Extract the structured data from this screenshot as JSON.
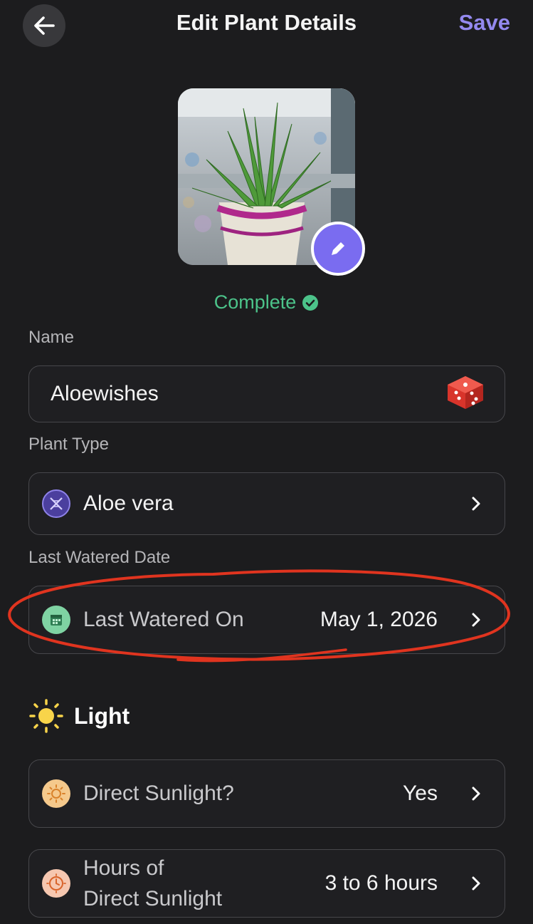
{
  "header": {
    "title": "Edit Plant Details",
    "save_label": "Save",
    "accent_color": "#9489ef"
  },
  "photo": {
    "icon": "pencil-icon"
  },
  "status": {
    "text": "Complete",
    "color": "#4cc38a",
    "icon": "check-circle-icon"
  },
  "name": {
    "label": "Name",
    "value": "Aloewishes",
    "icon": "dice-icon"
  },
  "plant_type": {
    "label": "Plant Type",
    "value": "Aloe vera",
    "icon": "dna-icon"
  },
  "last_watered": {
    "label": "Last Watered Date",
    "row_label": "Last Watered On",
    "value": "May 1, 2026",
    "icon": "calendar-icon",
    "annotation_color": "#e0341f"
  },
  "light": {
    "section_title": "Light",
    "icon": "sun-icon",
    "rows": [
      {
        "label": "Direct Sunlight?",
        "value": "Yes",
        "icon": "sun-icon"
      },
      {
        "label_line1": "Hours of",
        "label_line2": "Direct Sunlight",
        "value": "3 to 6 hours",
        "icon": "clock-sun-icon"
      }
    ]
  }
}
